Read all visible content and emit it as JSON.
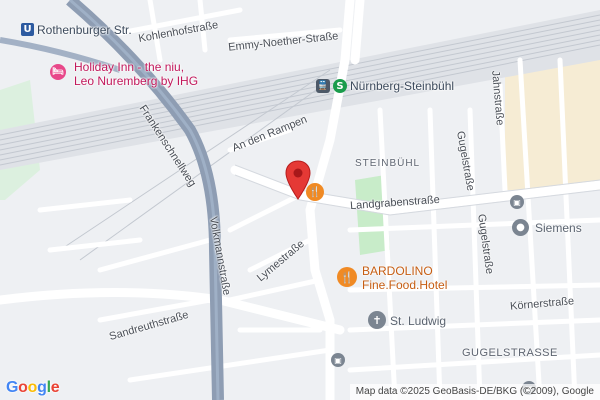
{
  "map": {
    "streets": {
      "rothenburger": "Rothenburger Str.",
      "kohlenhof": "Kohlenhofstraße",
      "emmy_noether": "Emmy-Noether-Straße",
      "an_den_rampen": "An den Rampen",
      "frankenschnellweg": "Frankenschnellweg",
      "volkmannstrasse": "Volkmannstraße",
      "lymestrasse": "Lymestraße",
      "landgrabenstrasse": "Landgrabenstraße",
      "gugelstrasse_upper": "Gugelstraße",
      "gugelstrasse_lower": "Gugelstraße",
      "jahnstrasse": "Jahnstraße",
      "koernerstrasse": "Körnerstraße",
      "sandreuthstrasse": "Sandreuthstraße"
    },
    "areas": {
      "steinbuehl": "STEINBÜHL",
      "gugelstrasse_area": "GUGELSTRASSE"
    },
    "pois": {
      "holiday_inn": {
        "line1": "Holiday Inn - the niu,",
        "line2": "Leo Nuremberg by IHG",
        "color": "#e8488a"
      },
      "bardolino": {
        "line1": "BARDOLINO",
        "line2": "Fine.Food.Hotel",
        "color": "#f08a24"
      },
      "siemens": {
        "label": "Siemens",
        "color": "#7b8591"
      },
      "st_ludwig": {
        "label": "St. Ludwig",
        "color": "#7b8591"
      }
    },
    "transit": {
      "station": "Nürnberg-Steinbühl",
      "ubahn_label": "Rothenburger Str.",
      "sbahn_color": "#1a9c4c",
      "ubahn_color": "#2c5aa0"
    },
    "marker_color": "#e53935",
    "road_highway_color": "#8e9db3",
    "park_color": "#c8ecc9",
    "attribution": "Map data ©2025 GeoBasis-DE/BKG (©2009), Google",
    "logo": "Google"
  }
}
